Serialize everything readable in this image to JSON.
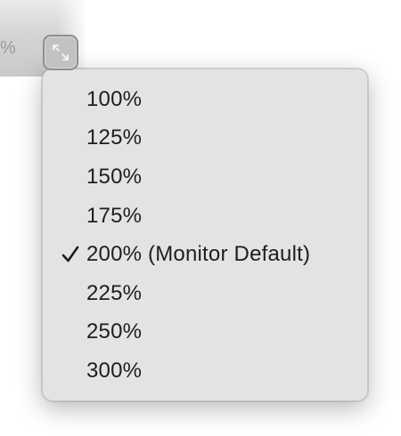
{
  "toolbar": {
    "percent_fragment": "%",
    "resize_icon": "expand-arrows-icon"
  },
  "zoom_menu": {
    "items": [
      {
        "label": "100%",
        "checked": false
      },
      {
        "label": "125%",
        "checked": false
      },
      {
        "label": "150%",
        "checked": false
      },
      {
        "label": "175%",
        "checked": false
      },
      {
        "label": "200% (Monitor Default)",
        "checked": true
      },
      {
        "label": "225%",
        "checked": false
      },
      {
        "label": "250%",
        "checked": false
      },
      {
        "label": "300%",
        "checked": false
      }
    ],
    "check_icon": "checkmark-icon"
  },
  "colors": {
    "menu_background": "#e3e3e3",
    "menu_text": "#1e1e1e",
    "button_border": "#8e8e8e"
  }
}
